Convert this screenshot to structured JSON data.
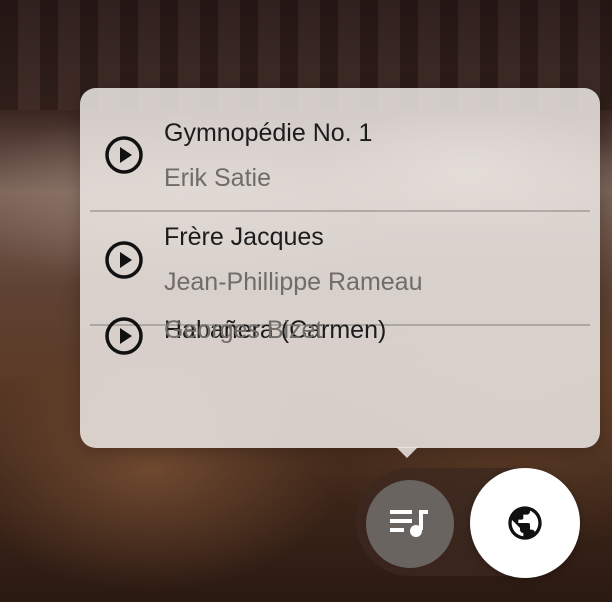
{
  "playlist": {
    "tracks": [
      {
        "title": "Gymnopédie No. 1",
        "artist": "Erik Satie",
        "icon": "play-circle-icon"
      },
      {
        "title": "Frère Jacques",
        "artist": "Jean-Phillippe Rameau",
        "icon": "play-circle-icon"
      },
      {
        "title": "Habañera (Carmen)",
        "artist": "Georges Bizet",
        "icon": "play-circle-icon"
      }
    ]
  },
  "controls": {
    "queue_icon": "queue-music-icon",
    "globe_icon": "globe-icon"
  },
  "colors": {
    "popup_bg": "#ECE8E4",
    "title_text": "#1C1C1C",
    "artist_text": "#6F6C69",
    "queue_button_bg": "#6A6460",
    "globe_button_bg": "#FFFFFF"
  }
}
